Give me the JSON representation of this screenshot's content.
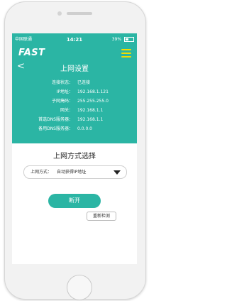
{
  "status_bar": {
    "carrier": "中国联通",
    "time": "14:21",
    "battery": "39%"
  },
  "header": {
    "logo": "FAST",
    "title": "上网设置",
    "back": "<"
  },
  "info": [
    {
      "label": "连接状态：",
      "value": "已连接"
    },
    {
      "label": "IP地址：",
      "value": "192.168.1.121"
    },
    {
      "label": "子网掩码：",
      "value": "255.255.255.0"
    },
    {
      "label": "网关：",
      "value": "192.168.1.1"
    },
    {
      "label": "首选DNS服务器：",
      "value": "192.168.1.1"
    },
    {
      "label": "备用DNS服务器：",
      "value": "0.0.0.0"
    }
  ],
  "section": {
    "title": "上网方式选择",
    "select_label": "上网方式：",
    "select_value": "自动获得IP地址"
  },
  "actions": {
    "disconnect": "断开",
    "redetect": "重新检测"
  },
  "colors": {
    "accent": "#2bb5a4",
    "menu_icon": "#f2dd00"
  }
}
